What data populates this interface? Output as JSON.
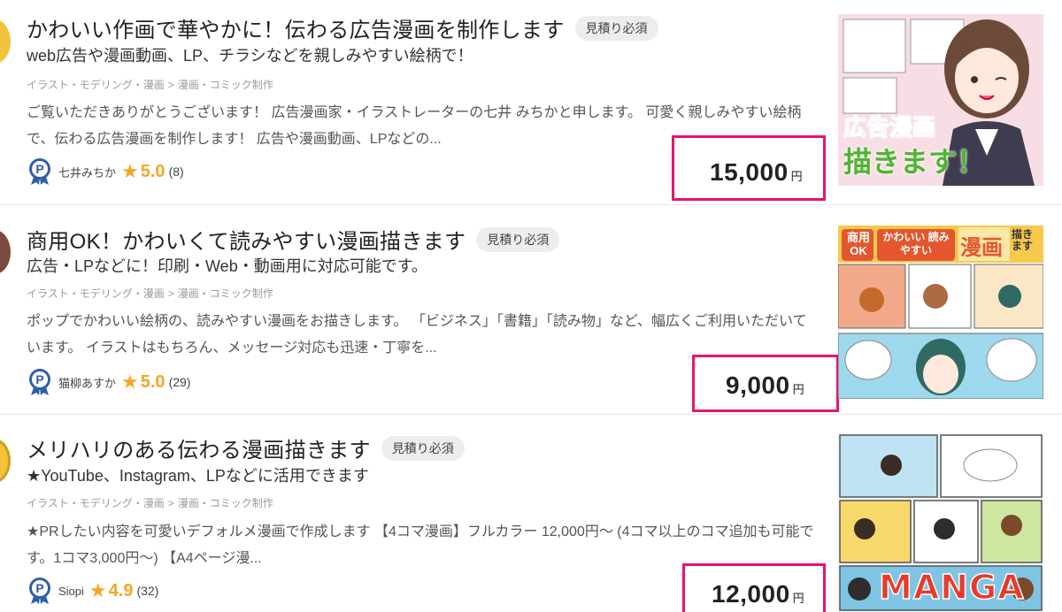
{
  "listings": [
    {
      "title": "かわいい作画で華やかに！伝わる広告漫画を制作します",
      "badge": "見積り必須",
      "subtitle": "web広告や漫画動画、LP、チラシなどを親しみやすい絵柄で！",
      "breadcrumb": [
        "イラスト・モデリング・漫画",
        ">",
        "漫画・コミック制作"
      ],
      "description": "ご覧いただきありがとうございます！ 広告漫画家・イラストレーターの七井 みちかと申します。 可愛く親しみやすい絵柄で、伝わる広告漫画を制作します！ 広告や漫画動画、LPなどの...",
      "seller": "七井みちか",
      "rating": "5.0",
      "reviews": "(8)",
      "price": "15,000",
      "currency": "円",
      "thumb_text": [
        "広告漫画",
        "描きます！"
      ]
    },
    {
      "title": "商用OK！かわいくて読みやすい漫画描きます",
      "badge": "見積り必須",
      "subtitle": "広告・LPなどに！印刷・Web・動画用に対応可能です。",
      "breadcrumb": [
        "イラスト・モデリング・漫画",
        ">",
        "漫画・コミック制作"
      ],
      "description": "ポップでかわいい絵柄の、読みやすい漫画をお描きします。 「ビジネス」「書籍」「読み物」など、幅広くご利用いただいています。 イラストはもちろん、メッセージ対応も迅速・丁寧を...",
      "seller": "猫柳あすか",
      "rating": "5.0",
      "reviews": "(29)",
      "price": "9,000",
      "currency": "円",
      "thumb_text": [
        "商用OK",
        "かわいい 読みやすい",
        "漫画",
        "描きます"
      ]
    },
    {
      "title": "メリハリのある伝わる漫画描きます",
      "badge": "見積り必須",
      "subtitle": "★YouTube、Instagram、LPなどに活用できます",
      "breadcrumb": [
        "イラスト・モデリング・漫画",
        ">",
        "漫画・コミック制作"
      ],
      "description": "★PRしたい内容を可愛いデフォルメ漫画で作成します 【4コマ漫画】フルカラー 12,000円〜 (4コマ以上のコマ追加も可能です。1コマ3,000円〜) 【A4ページ漫...",
      "seller": "Siopi",
      "rating": "4.9",
      "reviews": "(32)",
      "price": "12,000",
      "currency": "円",
      "thumb_text": [
        "MANGA"
      ]
    }
  ],
  "icons": {
    "seller_badge": "pro-badge-icon",
    "star": "star-icon"
  },
  "colors": {
    "highlight": "#e8136e",
    "star": "#f5a623",
    "badge_blue": "#2f5fa8"
  }
}
